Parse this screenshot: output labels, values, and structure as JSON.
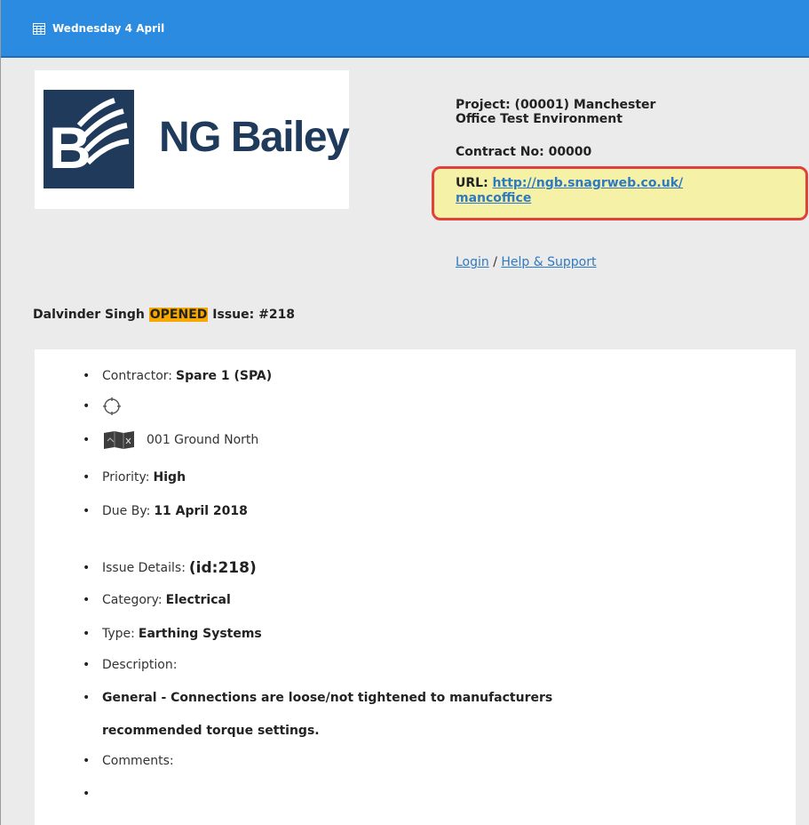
{
  "header": {
    "date": "Wednesday 4 April",
    "calendar_icon": "calendar-icon"
  },
  "logo": {
    "text": "NG Bailey"
  },
  "project": {
    "line1": "Project: (00001) Manchester",
    "line2": "Office Test Environment",
    "contract": "Contract No: 00000",
    "url_label": "URL: ",
    "url_line1": "http://ngb.snagrweb.co.uk/",
    "url_line2": "mancoffice",
    "login_label": "Login",
    "separator": " / ",
    "help_label": "Help & Support"
  },
  "event": {
    "user": "Dalvinder Singh",
    "action": "OPENED",
    "issue_label": "Issue: #218"
  },
  "details": {
    "contractor_label": "Contractor: ",
    "contractor_value": "Spare 1 (SPA)",
    "location": "001 Ground North",
    "priority_label": "Priority: ",
    "priority_value": "High",
    "due_label": "Due By: ",
    "due_value": "11 April 2018",
    "issue_details_label": "Issue Details: ",
    "issue_details_value": "(id:218)",
    "category_label": "Category: ",
    "category_value": "Electrical",
    "type_label": "Type: ",
    "type_value": "Earthing Systems",
    "description_label": "Description:",
    "description_line1": "General - Connections are loose/not tightened to manufacturers",
    "description_line2": "recommended torque settings.",
    "comments_label": "Comments:"
  },
  "colors": {
    "header_blue": "#2b8be0",
    "highlight_orange": "#f7a800",
    "url_box_border": "#e0413a",
    "url_box_fill": "#f5f2a8",
    "link_blue": "#2f79c1"
  }
}
